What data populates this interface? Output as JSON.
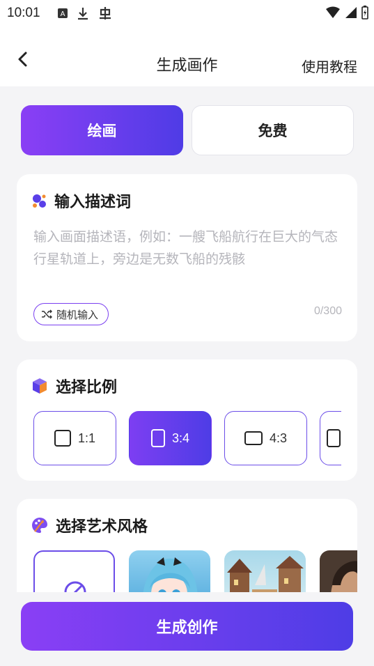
{
  "status_bar": {
    "time": "10:01"
  },
  "header": {
    "title": "生成画作",
    "help_label": "使用教程"
  },
  "tabs": [
    {
      "label": "绘画",
      "active": true
    },
    {
      "label": "免费",
      "active": false
    }
  ],
  "prompt_card": {
    "title": "输入描述词",
    "placeholder": "输入画面描述语，例如：一艘飞船航行在巨大的气态行星轨道上，旁边是无数飞船的残骸",
    "random_label": "随机输入",
    "counter": "0/300"
  },
  "ratio_card": {
    "title": "选择比例",
    "options": [
      {
        "label": "1:1",
        "selected": false
      },
      {
        "label": "3:4",
        "selected": true
      },
      {
        "label": "4:3",
        "selected": false
      }
    ]
  },
  "style_card": {
    "title": "选择艺术风格"
  },
  "generate_label": "生成创作",
  "colors": {
    "accent_start": "#8a3ff5",
    "accent_end": "#4e3de6"
  }
}
